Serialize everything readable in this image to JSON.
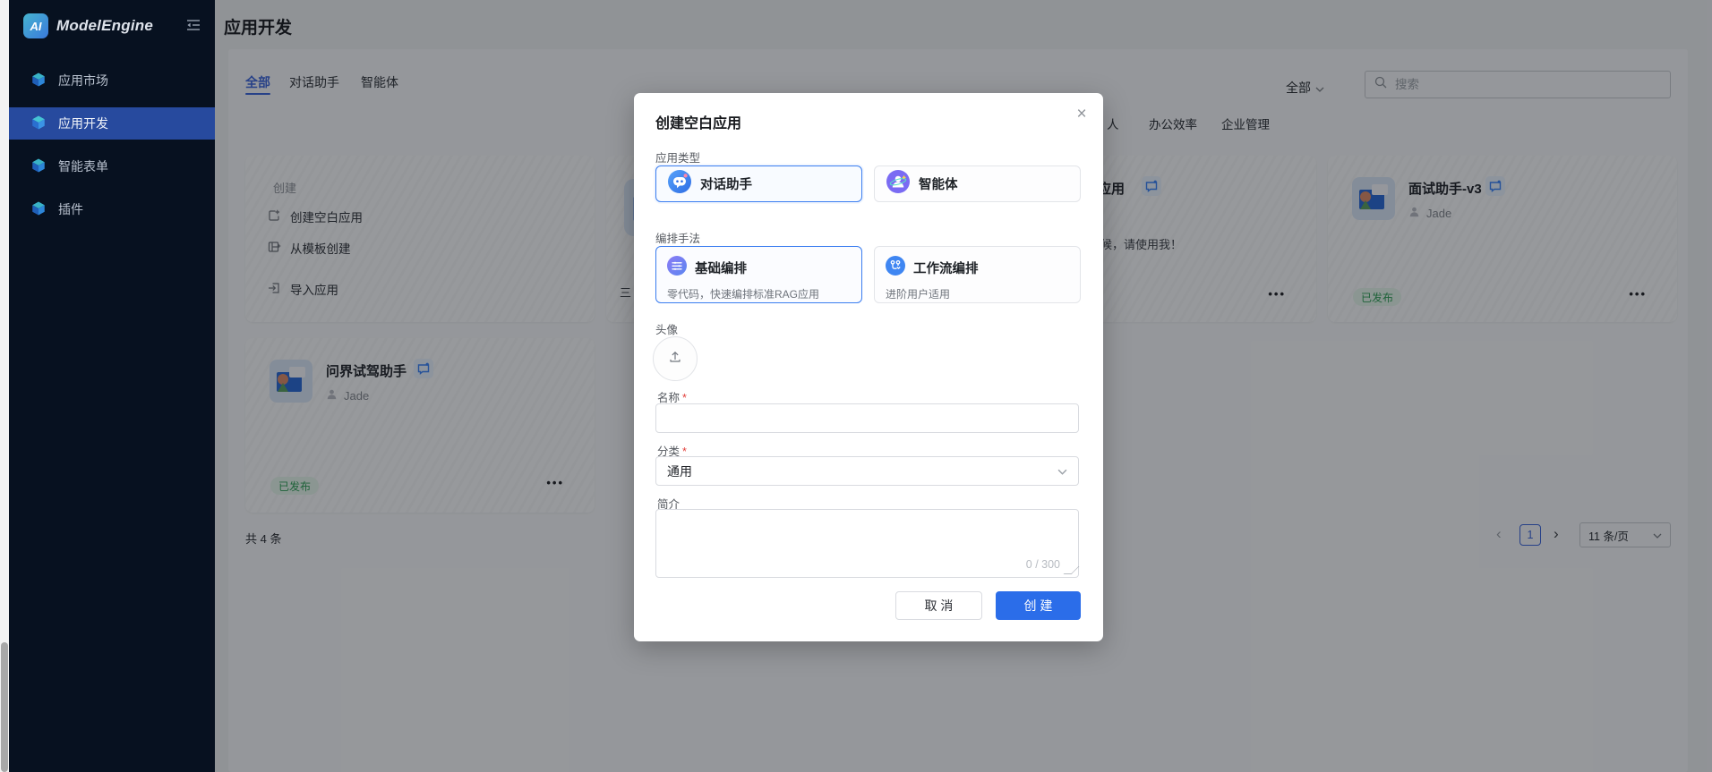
{
  "colors": {
    "accent": "#2b6de9",
    "sidebar_bg": "#071120",
    "sidebar_active": "#274a9e",
    "tab_active": "#3d66d9",
    "status_green": "#2f9e57",
    "mask": "rgba(8,11,16,0.40)"
  },
  "sidebar": {
    "logo_badge": "AI",
    "logo_text": "ModelEngine",
    "items": [
      {
        "label": "应用市场",
        "active": false
      },
      {
        "label": "应用开发",
        "active": true
      },
      {
        "label": "智能表单",
        "active": false
      },
      {
        "label": "插件",
        "active": false
      }
    ]
  },
  "header": {
    "title": "应用开发"
  },
  "main": {
    "tabs": [
      {
        "label": "全部",
        "active": true
      },
      {
        "label": "对话助手",
        "active": false
      },
      {
        "label": "智能体",
        "active": false
      }
    ],
    "filter_value": "全部",
    "search_placeholder": "搜索",
    "categories_visible": [
      "人",
      "办公效率",
      "企业管理"
    ],
    "create_card": {
      "title": "创建",
      "actions": [
        {
          "label": "创建空白应用"
        },
        {
          "label": "从模板创建"
        },
        {
          "label": "导入应用"
        }
      ]
    },
    "card_fragment_left": {
      "text": "三"
    },
    "card_fragment_mid": {
      "title": "应用",
      "desc": "候，请使用我！",
      "menu": "•••"
    },
    "apps": [
      {
        "title": "面试助手-v3",
        "author": "Jade",
        "status": "已发布",
        "menu": "•••"
      },
      {
        "title": "问界试驾助手",
        "author": "Jade",
        "status": "已发布",
        "menu": "•••"
      }
    ],
    "total": "共 4 条",
    "pagination": {
      "prev": "‹",
      "page": "1",
      "next": "›",
      "page_size": "11 条/页"
    }
  },
  "modal": {
    "title": "创建空白应用",
    "close": "×",
    "required_mark": "*",
    "app_type": {
      "label": "应用类型",
      "options": [
        {
          "label": "对话助手",
          "selected": true
        },
        {
          "label": "智能体",
          "selected": false
        }
      ]
    },
    "orchestration": {
      "label": "编排手法",
      "options": [
        {
          "label": "基础编排",
          "desc": "零代码，快速编排标准RAG应用",
          "selected": true
        },
        {
          "label": "工作流编排",
          "desc": "进阶用户适用",
          "selected": false
        }
      ]
    },
    "avatar_label": "头像",
    "name_field": {
      "label": "名称",
      "value": "",
      "placeholder": ""
    },
    "category_field": {
      "label": "分类",
      "value": "通用"
    },
    "intro_field": {
      "label": "简介",
      "value": "",
      "counter": "0 / 300"
    },
    "cancel_label": "取 消",
    "create_label": "创 建"
  }
}
